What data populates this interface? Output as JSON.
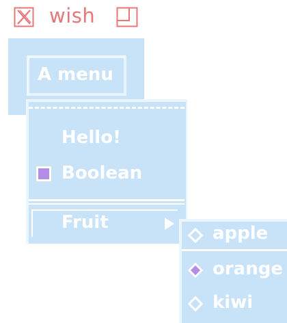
{
  "titlebar": {
    "close_icon": "close-x-icon",
    "title": "wish",
    "maximize_icon": "maximize-icon",
    "accent_color": "#e8777a"
  },
  "menubar": {
    "menu_label": "A menu"
  },
  "menu": {
    "items": [
      {
        "label": "Hello!",
        "type": "command"
      },
      {
        "label": "Boolean",
        "type": "checkbutton",
        "checked": true
      },
      {
        "label": "Fruit",
        "type": "cascade",
        "icon": "submenu-arrow-icon"
      }
    ]
  },
  "submenu": {
    "items": [
      {
        "label": "apple",
        "selected": false
      },
      {
        "label": "orange",
        "selected": true
      },
      {
        "label": "kiwi",
        "selected": false
      }
    ]
  },
  "colors": {
    "menu_bg": "#c8e2f8",
    "indicator": "#b38ce8",
    "text": "#ffffff"
  }
}
